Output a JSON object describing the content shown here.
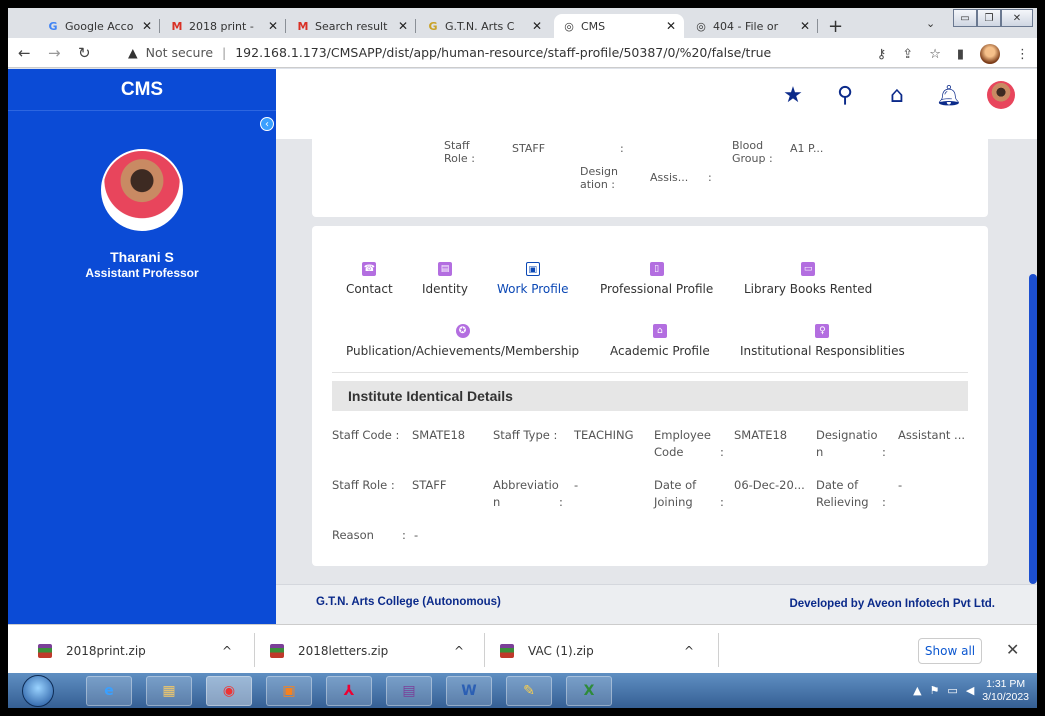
{
  "browser": {
    "tabs": [
      {
        "label": "Google Acco",
        "icon": "G"
      },
      {
        "label": "2018 print - ",
        "icon": "M"
      },
      {
        "label": "Search result",
        "icon": "M"
      },
      {
        "label": "G.T.N. Arts C",
        "icon": "G"
      },
      {
        "label": "CMS",
        "icon": "◎"
      },
      {
        "label": "404 - File or",
        "icon": "◎"
      }
    ],
    "new_tab": "+",
    "tab_search": "⌄",
    "address": {
      "warning": "▲",
      "not_secure": "Not secure",
      "url": "192.168.1.173/CMSAPP/dist/app/human-resource/staff-profile/50387/0/%20/false/true"
    }
  },
  "app": {
    "brand": "CMS",
    "user": {
      "name": "Tharani S",
      "role": "Assistant Professor"
    },
    "summary": {
      "staff_role_label": "Staff Role  :",
      "staff_role_value": "STAFF",
      "colon": ":",
      "blood_label": "Blood Group :",
      "blood_value": "A1 P...",
      "designation_label": "Design ation  :",
      "designation_value": "Assis..."
    },
    "profile_tabs": [
      {
        "label": "Contact",
        "icon": "☎"
      },
      {
        "label": "Identity",
        "icon": "▤"
      },
      {
        "label": "Work Profile",
        "icon": "▣"
      },
      {
        "label": "Professional Profile",
        "icon": "▯"
      },
      {
        "label": "Library Books Rented",
        "icon": "▭"
      },
      {
        "label": "Publication/Achievements/Membership",
        "icon": "✪"
      },
      {
        "label": "Academic Profile",
        "icon": "⌂"
      },
      {
        "label": "Institutional Responsiblities",
        "icon": "♀"
      }
    ],
    "section_title": "Institute Identical Details",
    "fields": {
      "staff_code_label": "Staff Code :",
      "staff_code_value": "SMATE18",
      "staff_type_label": "Staff Type  :",
      "staff_type_value": "TEACHING",
      "employee_code_label": "Employee Code",
      "employee_code_colon": ":",
      "employee_code_value": "SMATE18",
      "designation_label": "Designatio n",
      "designation_colon": ":",
      "designation_value": "Assistant ...",
      "staff_role_label": "Staff Role  :",
      "staff_role_value": "STAFF",
      "abbreviation_label": "Abbreviatio n",
      "abbreviation_colon": ":",
      "abbreviation_value": "-",
      "doj_label": "Date of Joining",
      "doj_colon": ":",
      "doj_value": "06-Dec-20...",
      "dor_label": "Date of Relieving",
      "dor_colon": ":",
      "dor_value": "-",
      "reason_label": "Reason",
      "reason_colon": ":",
      "reason_value": "-"
    },
    "footer": {
      "left": "G.T.N. Arts College (Autonomous)",
      "right": "Developed by Aveon Infotech Pvt Ltd."
    }
  },
  "downloads": {
    "items": [
      "2018print.zip",
      "2018letters.zip",
      "VAC (1).zip"
    ],
    "chev": "^",
    "show_all": "Show all",
    "close": "✕"
  },
  "taskbar": {
    "time": "1:31 PM",
    "date": "3/10/2023"
  },
  "colors": {
    "sidebar": "#0b4bd6",
    "accent": "#0b2a8a",
    "tab_icon": "#b36ee0"
  }
}
